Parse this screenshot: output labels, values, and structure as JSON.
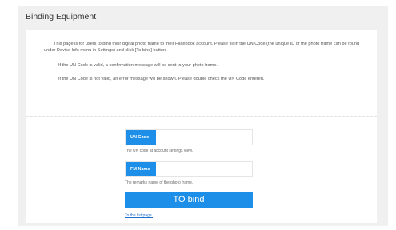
{
  "page": {
    "title": "Binding Equipment"
  },
  "info": {
    "paragraph1": "This page is for users to bind their digital photo frame to their Facebook account. Please fill in the UN Code (the unique ID of the photo frame can be found under Device Info menu in Settings) and click [To bind] button.",
    "paragraph2": "If the UN Code is valid, a confirmation message will be sent to your photo frame.",
    "paragraph3": "If the UN Code is not valid, an error message will be shown. Please double check the UN Code entered."
  },
  "form": {
    "un_code": {
      "label": "UN Code",
      "value": "",
      "hint": "The UN code at account settings view."
    },
    "fm_name": {
      "label": "FM Name",
      "value": "",
      "hint": "The remarks name of the photo frame."
    },
    "submit_label": "TO bind",
    "list_link": "To the list page."
  },
  "colors": {
    "accent": "#1e8fe8",
    "panel_bg": "#f0f0f0"
  }
}
